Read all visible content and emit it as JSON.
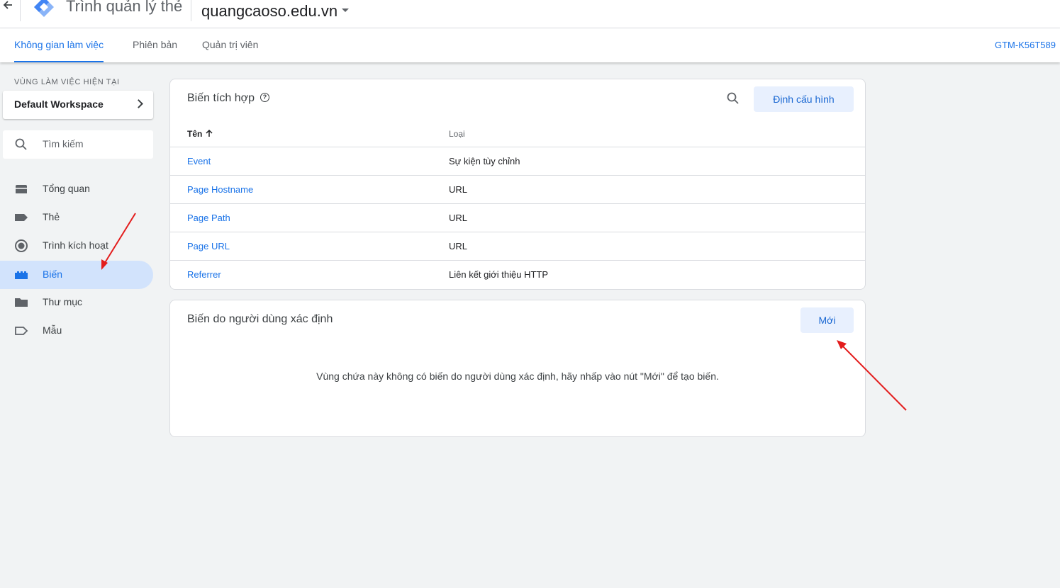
{
  "header": {
    "app_title": "Trình quản lý thẻ",
    "account": "quangcaoso.edu.vn",
    "back_icon": "arrow-left-icon",
    "logo_colors": [
      "#4285f4",
      "#8ab4f8"
    ]
  },
  "tabs": [
    {
      "label": "Không gian làm việc"
    },
    {
      "label": "Phiên bản"
    },
    {
      "label": "Quản trị viên"
    }
  ],
  "container_id": "GTM-K56T589",
  "sidebar": {
    "workspace_label": "VÙNG LÀM VIỆC HIỆN TẠI",
    "workspace_name": "Default Workspace",
    "search_placeholder": "Tìm kiếm",
    "items": [
      {
        "label": "Tổng quan",
        "icon": "overview-icon"
      },
      {
        "label": "Thẻ",
        "icon": "tag-icon"
      },
      {
        "label": "Trình kích hoạt",
        "icon": "trigger-icon"
      },
      {
        "label": "Biến",
        "icon": "variable-icon"
      },
      {
        "label": "Thư mục",
        "icon": "folder-icon"
      },
      {
        "label": "Mẫu",
        "icon": "template-icon"
      }
    ]
  },
  "builtin": {
    "title": "Biến tích hợp",
    "configure_label": "Định cấu hình",
    "col_name": "Tên",
    "col_type": "Loại",
    "rows": [
      {
        "name": "Event",
        "type": "Sự kiện tùy chỉnh"
      },
      {
        "name": "Page Hostname",
        "type": "URL"
      },
      {
        "name": "Page Path",
        "type": "URL"
      },
      {
        "name": "Page URL",
        "type": "URL"
      },
      {
        "name": "Referrer",
        "type": "Liên kết giới thiệu HTTP"
      }
    ]
  },
  "user_defined": {
    "title": "Biến do người dùng xác định",
    "new_label": "Mới",
    "empty_message": "Vùng chứa này không có biến do người dùng xác định, hãy nhấp vào nút \"Mới\" để tạo biến."
  },
  "colors": {
    "accent": "#1a73e8",
    "active_bg": "#d2e3fc",
    "annotation_arrow": "#e31c1c"
  }
}
